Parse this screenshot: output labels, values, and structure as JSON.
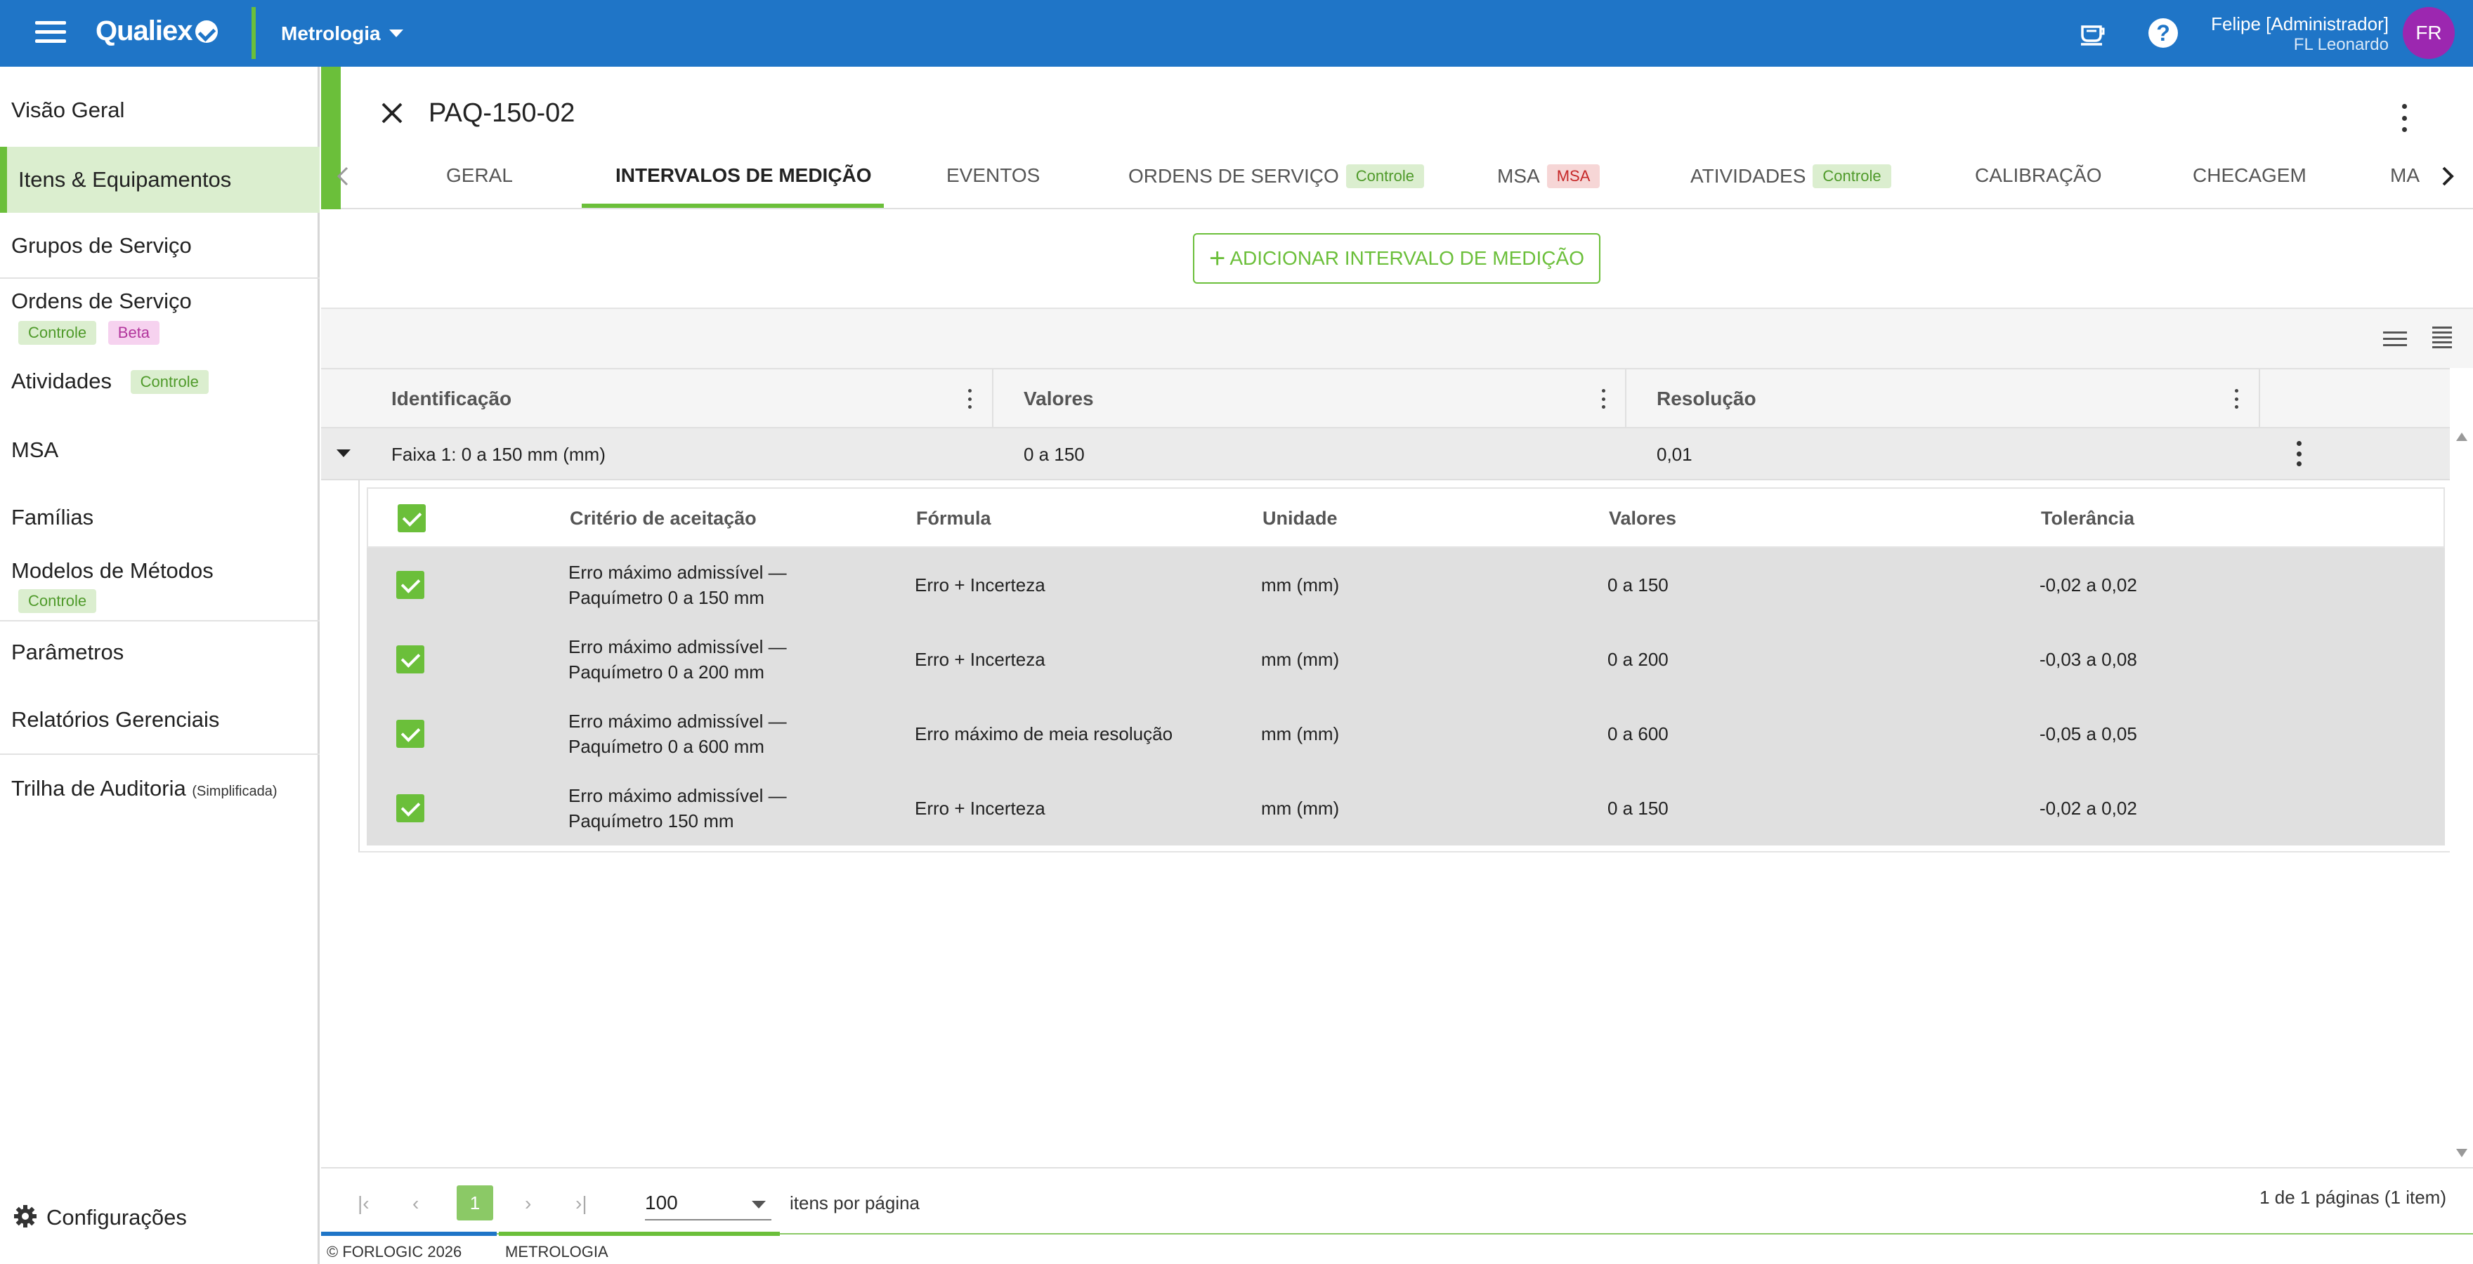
{
  "topbar": {
    "logo": "Qualiex",
    "module": "Metrologia",
    "user_name": "Felipe [Administrador]",
    "user_org": "FL Leonardo",
    "avatar_initials": "FR",
    "help_glyph": "?"
  },
  "sidebar": {
    "items": [
      {
        "label": "Visão Geral"
      },
      {
        "label": "Itens & Equipamentos"
      },
      {
        "label": "Grupos de Serviço"
      },
      {
        "label": "Ordens de Serviço",
        "badges": [
          "Controle",
          "Beta"
        ]
      },
      {
        "label": "Atividades",
        "badge": "Controle"
      },
      {
        "label": "MSA"
      },
      {
        "label": "Famílias"
      },
      {
        "label": "Modelos de Métodos",
        "badge": "Controle"
      },
      {
        "label": "Parâmetros"
      },
      {
        "label": "Relatórios Gerenciais"
      },
      {
        "label": "Trilha de Auditoria",
        "suffix": "(Simplificada)"
      }
    ],
    "config_label": "Configurações"
  },
  "record": {
    "title": "PAQ-150-02"
  },
  "tabs": [
    {
      "label": "GERAL"
    },
    {
      "label": "INTERVALOS DE MEDIÇÃO"
    },
    {
      "label": "EVENTOS"
    },
    {
      "label": "ORDENS DE SERVIÇO",
      "badge": "Controle"
    },
    {
      "label": "MSA",
      "badge": "MSA"
    },
    {
      "label": "ATIVIDADES",
      "badge": "Controle"
    },
    {
      "label": "CALIBRAÇÃO"
    },
    {
      "label": "CHECAGEM"
    },
    {
      "label": "MA"
    }
  ],
  "add_button_label": "ADICIONAR INTERVALO DE MEDIÇÃO",
  "grid": {
    "columns": [
      "Identificação",
      "Valores",
      "Resolução"
    ],
    "group": {
      "identificacao": "Faixa 1: 0 a 150 mm (mm)",
      "valores": "0 a 150",
      "resolucao": "0,01"
    },
    "detail_columns": [
      "Critério de aceitação",
      "Fórmula",
      "Unidade",
      "Valores",
      "Tolerância"
    ],
    "detail_rows": [
      {
        "criterio_1": "Erro máximo admissível —",
        "criterio_2": "Paquímetro 0 a 150 mm",
        "formula": "Erro + Incerteza",
        "unidade": "mm (mm)",
        "valores": "0 a 150",
        "tolerancia": "-0,02 a 0,02"
      },
      {
        "criterio_1": "Erro máximo admissível —",
        "criterio_2": "Paquímetro 0 a 200 mm",
        "formula": "Erro + Incerteza",
        "unidade": "mm (mm)",
        "valores": "0 a 200",
        "tolerancia": "-0,03 a 0,08"
      },
      {
        "criterio_1": "Erro máximo admissível —",
        "criterio_2": "Paquímetro 0 a 600 mm",
        "formula": "Erro máximo de meia resolução",
        "unidade": "mm (mm)",
        "valores": "0 a 600",
        "tolerancia": "-0,05 a 0,05"
      },
      {
        "criterio_1": "Erro máximo admissível —",
        "criterio_2": "Paquímetro 150 mm",
        "formula": "Erro + Incerteza",
        "unidade": "mm (mm)",
        "valores": "0 a 150",
        "tolerancia": "-0,02 a 0,02"
      }
    ]
  },
  "pager": {
    "current_page": "1",
    "page_size": "100",
    "page_size_label": "itens por página",
    "info": "1 de 1 páginas (1 item)",
    "first_glyph": "|‹",
    "prev_glyph": "‹",
    "next_glyph": "›",
    "last_glyph": "›|"
  },
  "footer": {
    "copyright": "© FORLOGIC 2026",
    "module": "METROLOGIA"
  },
  "colors": {
    "topbar": "#1f75c7",
    "accent_green": "#6bbf3a",
    "avatar": "#9c27b0"
  },
  "icons": [
    "menu-icon",
    "logo-check-icon",
    "coffee-cup-icon",
    "help-icon",
    "close-icon",
    "more-vert-icon",
    "chevron-left-icon",
    "chevron-right-icon",
    "plus-icon",
    "list-view-icon",
    "compact-view-icon",
    "expand-caret-icon",
    "checkbox-checked-icon",
    "gear-icon"
  ]
}
